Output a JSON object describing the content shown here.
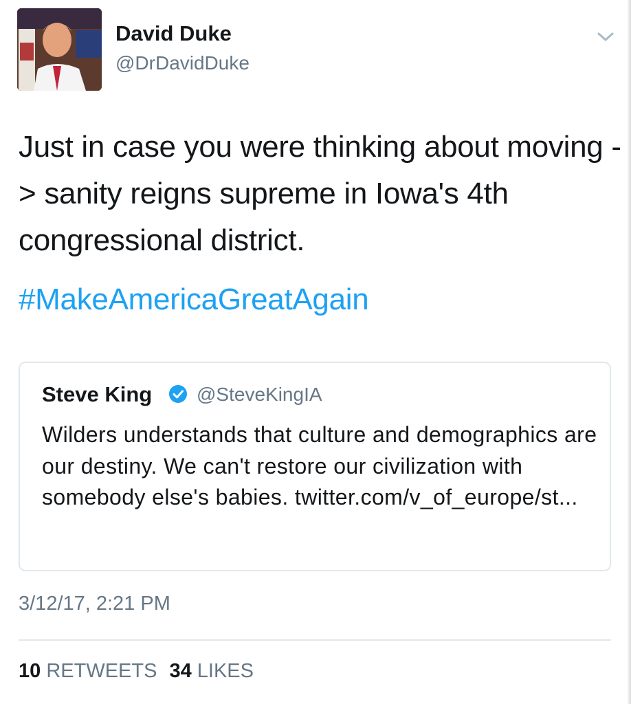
{
  "author": {
    "display_name": "David Duke",
    "handle": "@DrDavidDuke"
  },
  "tweet": {
    "text": "Just in case you were thinking about moving -> sanity reigns supreme in Iowa's 4th congressional district.",
    "hashtag": "#MakeAmericaGreatAgain"
  },
  "quoted_tweet": {
    "display_name": "Steve King",
    "handle": "@SteveKingIA",
    "text": "Wilders understands that culture and demographics are our destiny. We can't restore our civilization with somebody else's babies. twitter.com/v_of_europe/st..."
  },
  "timestamp": "3/12/17, 2:21 PM",
  "stats": {
    "retweets_count": "10",
    "retweets_label": "RETWEETS",
    "likes_count": "34",
    "likes_label": "LIKES"
  },
  "colors": {
    "link_blue": "#1da1f2",
    "secondary_gray": "#657786",
    "border": "#e1e8ed"
  },
  "icons": {
    "menu": "chevron-down-icon",
    "verified": "verified-badge-icon"
  }
}
